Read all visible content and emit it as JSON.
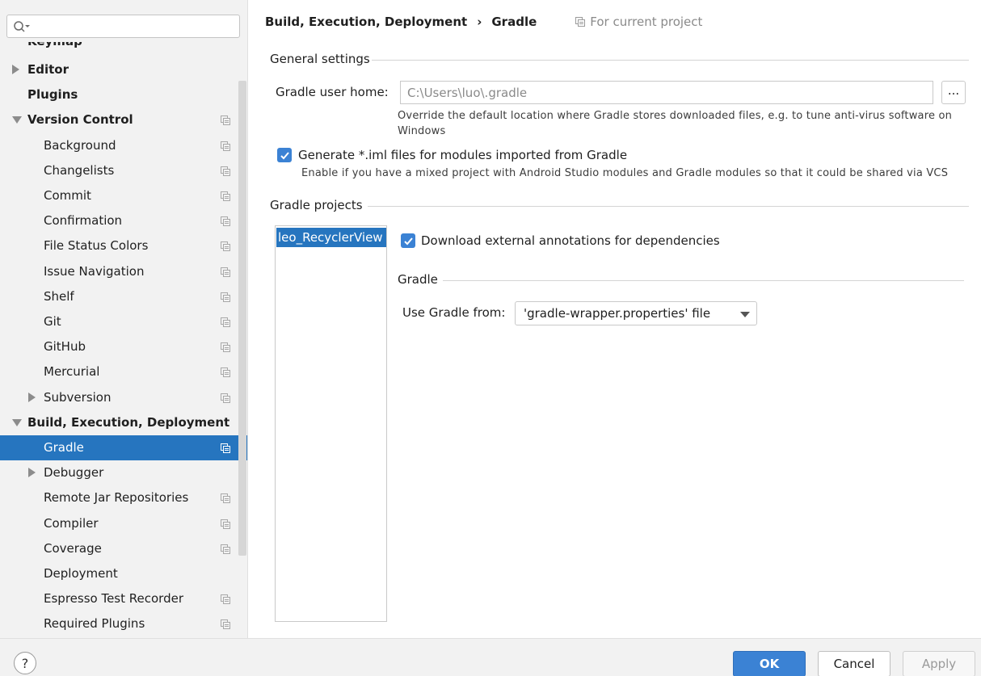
{
  "sidebar": {
    "search_placeholder": "",
    "cut_off_item": "Keymap",
    "items": [
      {
        "label": "Editor",
        "level": 0,
        "bold": true,
        "arrow": "right",
        "icon": false
      },
      {
        "label": "Plugins",
        "level": 0,
        "bold": true,
        "arrow": "",
        "icon": false
      },
      {
        "label": "Version Control",
        "level": 0,
        "bold": true,
        "arrow": "down",
        "icon": true
      },
      {
        "label": "Background",
        "level": 1,
        "bold": false,
        "arrow": "",
        "icon": true
      },
      {
        "label": "Changelists",
        "level": 1,
        "bold": false,
        "arrow": "",
        "icon": true
      },
      {
        "label": "Commit",
        "level": 1,
        "bold": false,
        "arrow": "",
        "icon": true
      },
      {
        "label": "Confirmation",
        "level": 1,
        "bold": false,
        "arrow": "",
        "icon": true
      },
      {
        "label": "File Status Colors",
        "level": 1,
        "bold": false,
        "arrow": "",
        "icon": true
      },
      {
        "label": "Issue Navigation",
        "level": 1,
        "bold": false,
        "arrow": "",
        "icon": true
      },
      {
        "label": "Shelf",
        "level": 1,
        "bold": false,
        "arrow": "",
        "icon": true
      },
      {
        "label": "Git",
        "level": 1,
        "bold": false,
        "arrow": "",
        "icon": true
      },
      {
        "label": "GitHub",
        "level": 1,
        "bold": false,
        "arrow": "",
        "icon": true
      },
      {
        "label": "Mercurial",
        "level": 1,
        "bold": false,
        "arrow": "",
        "icon": true
      },
      {
        "label": "Subversion",
        "level": 1,
        "bold": false,
        "arrow": "right",
        "icon": true
      },
      {
        "label": "Build, Execution, Deployment",
        "level": 0,
        "bold": true,
        "arrow": "down",
        "icon": false
      },
      {
        "label": "Gradle",
        "level": 1,
        "bold": false,
        "arrow": "",
        "icon": true,
        "selected": true
      },
      {
        "label": "Debugger",
        "level": 1,
        "bold": false,
        "arrow": "right",
        "icon": false
      },
      {
        "label": "Remote Jar Repositories",
        "level": 1,
        "bold": false,
        "arrow": "",
        "icon": true
      },
      {
        "label": "Compiler",
        "level": 1,
        "bold": false,
        "arrow": "",
        "icon": true
      },
      {
        "label": "Coverage",
        "level": 1,
        "bold": false,
        "arrow": "",
        "icon": true
      },
      {
        "label": "Deployment",
        "level": 1,
        "bold": false,
        "arrow": "",
        "icon": false
      },
      {
        "label": "Espresso Test Recorder",
        "level": 1,
        "bold": false,
        "arrow": "",
        "icon": true
      },
      {
        "label": "Required Plugins",
        "level": 1,
        "bold": false,
        "arrow": "",
        "icon": true
      }
    ]
  },
  "header": {
    "breadcrumb_parent": "Build, Execution, Deployment",
    "breadcrumb_separator": "›",
    "breadcrumb_current": "Gradle",
    "scope_label": "For current project"
  },
  "general": {
    "section_title": "General settings",
    "user_home_label": "Gradle user home:",
    "user_home_value": "C:\\Users\\luo\\.gradle",
    "browse_label": "...",
    "user_home_hint_1": "Override the default location where Gradle stores downloaded files, e.g. to tune anti-virus software on",
    "user_home_hint_2": "Windows",
    "generate_iml_label": "Generate *.iml files for modules imported from Gradle",
    "generate_iml_checked": true,
    "generate_iml_hint": "Enable if you have a mixed project with Android Studio modules and Gradle modules so that it could be shared via VCS"
  },
  "projects": {
    "section_title": "Gradle projects",
    "list": [
      "leo_RecyclerView"
    ],
    "download_annotations_label": "Download external annotations for dependencies",
    "download_annotations_checked": true,
    "gradle_section_title": "Gradle",
    "use_gradle_from_label": "Use Gradle from:",
    "use_gradle_from_value": "'gradle-wrapper.properties' file"
  },
  "footer": {
    "help_label": "?",
    "ok_label": "OK",
    "cancel_label": "Cancel",
    "apply_label": "Apply"
  },
  "colors": {
    "selection": "#2675bf",
    "accent_button": "#3b82d4",
    "sidebar_bg": "#f2f2f2"
  }
}
